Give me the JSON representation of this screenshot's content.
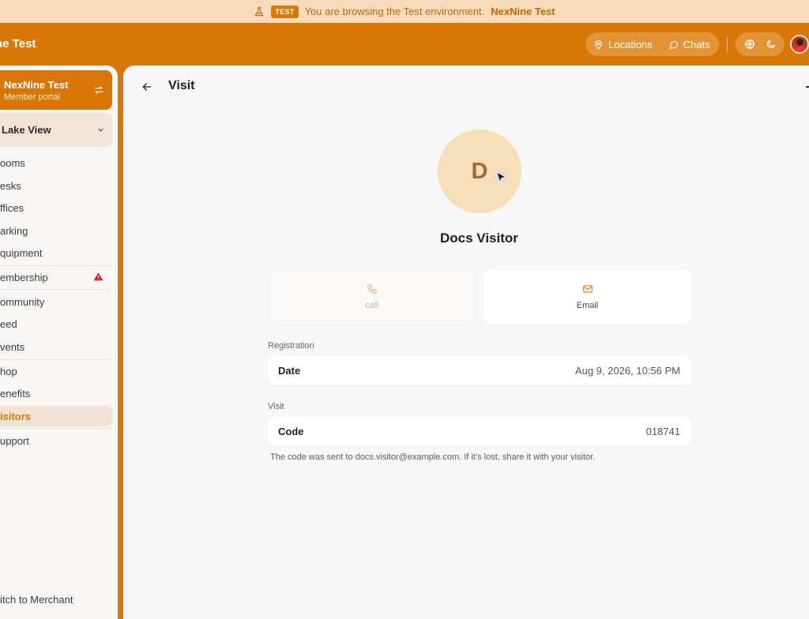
{
  "banner": {
    "badge": "TEST",
    "text": "You are browsing the Test environment.",
    "env_name": "NexNine Test"
  },
  "topbar": {
    "brand": "ne Test",
    "locations_label": "Locations",
    "chats_label": "Chats"
  },
  "sidebar": {
    "org_name": "NexNine Test",
    "org_sub": "Member portal",
    "location": "Lake View",
    "items": [
      {
        "label": "ooms"
      },
      {
        "label": "esks"
      },
      {
        "label": "ffices"
      },
      {
        "label": "arking"
      },
      {
        "label": "quipment"
      },
      {
        "label": "embership"
      },
      {
        "label": "ommunity"
      },
      {
        "label": "eed"
      },
      {
        "label": "vents"
      },
      {
        "label": "hop"
      },
      {
        "label": "enefits"
      },
      {
        "label": "isitors"
      },
      {
        "label": "upport"
      }
    ],
    "switch_label": "itch to Merchant"
  },
  "main": {
    "title": "Visit",
    "avatar_initial": "D",
    "visitor_name": "Docs Visitor",
    "call_label": "call",
    "email_label": "Email",
    "registration_label": "Registration",
    "date_key": "Date",
    "date_value": "Aug 9, 2026, 10:56 PM",
    "visit_label": "Visit",
    "code_key": "Code",
    "code_value": "018741",
    "note": "The code was sent to docs.visitor@example.com. If it's lost, share it with your visitor."
  },
  "colors": {
    "accent": "#d97706",
    "banner_bg": "#f6dcbc",
    "warning": "#dc2626"
  }
}
